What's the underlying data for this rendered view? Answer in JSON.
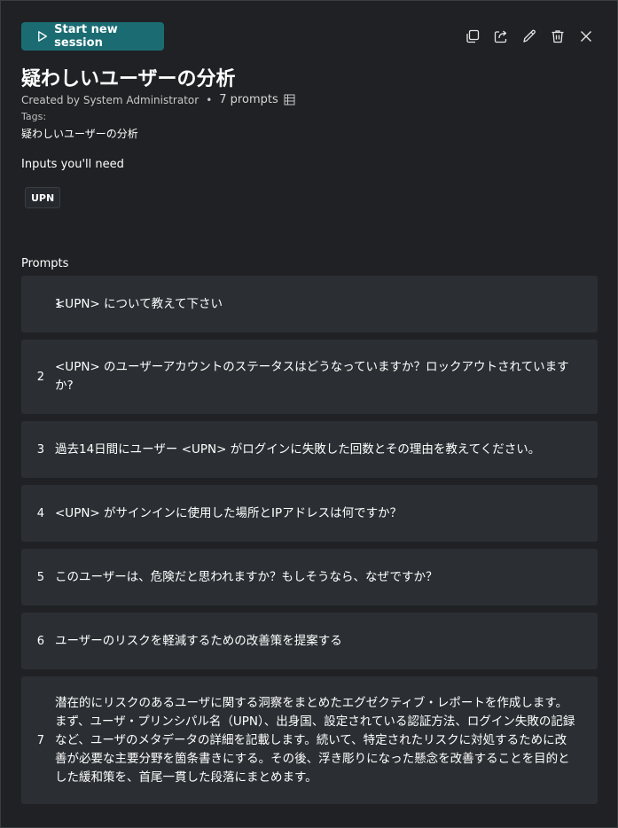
{
  "header": {
    "start_label": "Start new session",
    "actions": [
      "copy-icon",
      "share-icon",
      "edit-icon",
      "delete-icon",
      "close-icon"
    ]
  },
  "title": "疑わしいユーザーの分析",
  "meta": {
    "created_by": "Created by System Administrator",
    "bullet": "•",
    "prompt_count": "7 prompts"
  },
  "tags": {
    "label": "Tags:",
    "value": "疑わしいユーザーの分析"
  },
  "inputs": {
    "label": "Inputs you'll need",
    "items": [
      "UPN"
    ]
  },
  "prompts_label": "Prompts",
  "prompts": [
    {
      "num": "1",
      "text": "<UPN> について教えて下さい"
    },
    {
      "num": "2",
      "text": "<UPN> のユーザーアカウントのステータスはどうなっていますか？ロックアウトされていますか?"
    },
    {
      "num": "3",
      "text": "過去14日間にユーザー <UPN> がログインに失敗した回数とその理由を教えてください。"
    },
    {
      "num": "4",
      "text": "<UPN> がサインインに使用した場所とIPアドレスは何ですか？"
    },
    {
      "num": "5",
      "text": "このユーザーは、危険だと思われますか？もしそうなら、なぜですか？"
    },
    {
      "num": "6",
      "text": "ユーザーのリスクを軽減するための改善策を提案する"
    },
    {
      "num": "7",
      "text": "潜在的にリスクのあるユーザに関する洞察をまとめたエグゼクティブ・レポートを作成します。まず、ユーザ・プリンシパル名（UPN）、出身国、設定されている認証方法、ログイン失敗の記録など、ユーザのメタデータの詳細を記載します。続いて、特定されたリスクに対処するために改善が必要な主要分野を箇条書きにする。その後、浮き彫りになった懸念を改善することを目的とした緩和策を、首尾一貫した段落にまとめます。"
    }
  ]
}
